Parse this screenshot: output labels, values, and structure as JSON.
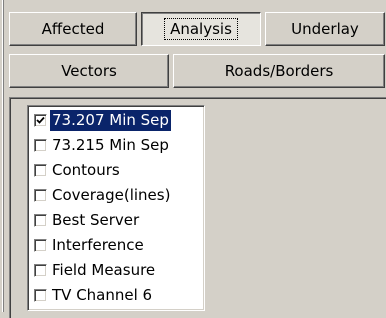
{
  "tabs_row1": [
    {
      "label": "Affected",
      "active": false
    },
    {
      "label": "Analysis",
      "active": true
    },
    {
      "label": "Underlay",
      "active": false
    }
  ],
  "tabs_row2": [
    {
      "label": "Vectors",
      "active": false
    },
    {
      "label": "Roads/Borders",
      "active": false
    }
  ],
  "layers": [
    {
      "label": "73.207 Min Sep",
      "checked": true,
      "selected": true
    },
    {
      "label": "73.215 Min Sep",
      "checked": false,
      "selected": false
    },
    {
      "label": "Contours",
      "checked": false,
      "selected": false
    },
    {
      "label": "Coverage(lines)",
      "checked": false,
      "selected": false
    },
    {
      "label": "Best Server",
      "checked": false,
      "selected": false
    },
    {
      "label": "Interference",
      "checked": false,
      "selected": false
    },
    {
      "label": "Field Measure",
      "checked": false,
      "selected": false
    },
    {
      "label": "TV Channel 6",
      "checked": false,
      "selected": false
    }
  ],
  "colors": {
    "selection": "#0a246a",
    "face": "#d4d0c8"
  }
}
